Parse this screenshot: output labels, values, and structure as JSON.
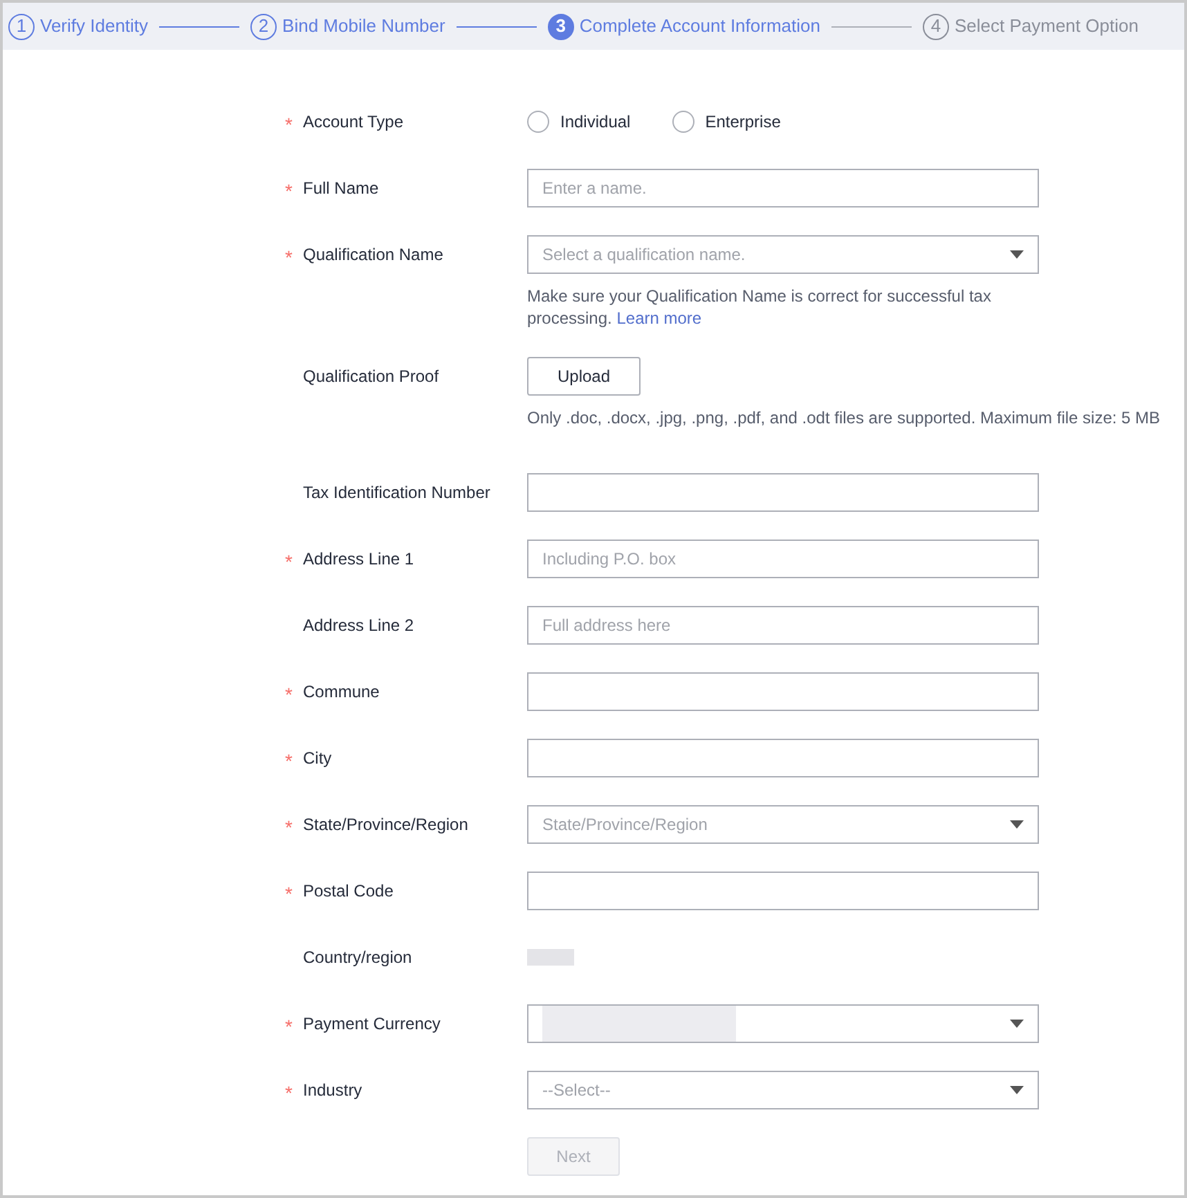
{
  "steps": [
    {
      "number": "1",
      "label": "Verify Identity",
      "completed": true,
      "selected": false
    },
    {
      "number": "2",
      "label": "Bind Mobile Number",
      "completed": true,
      "selected": false
    },
    {
      "number": "3",
      "label": "Complete Account Information",
      "completed": false,
      "selected": true
    },
    {
      "number": "4",
      "label": "Select Payment Option",
      "completed": false,
      "selected": false
    }
  ],
  "form": {
    "required_mark": "*",
    "fields": [
      {
        "kind": "radio",
        "label": "Account Type",
        "required": true,
        "options": [
          {
            "label": "Individual",
            "selected": false
          },
          {
            "label": "Enterprise",
            "selected": false
          }
        ]
      },
      {
        "kind": "input",
        "label": "Full Name",
        "required": true,
        "placeholder": "Enter a name."
      },
      {
        "kind": "select",
        "label": "Qualification Name",
        "required": true,
        "placeholder": "Select a qualification name.",
        "hint": "Make sure your Qualification Name is correct for successful tax processing.",
        "hint_link": "Learn more"
      },
      {
        "kind": "upload",
        "label": "Qualification Proof",
        "required": false,
        "button": "Upload",
        "hint": "Only .doc, .docx, .jpg, .png, .pdf, and .odt files are supported. Maximum file size: 5 MB"
      },
      {
        "kind": "input",
        "label": "Tax Identification Number",
        "required": false
      },
      {
        "kind": "input",
        "label": "Address Line 1",
        "required": true,
        "placeholder": "Including P.O. box"
      },
      {
        "kind": "input",
        "label": "Address Line 2",
        "required": false,
        "placeholder": "Full address here"
      },
      {
        "kind": "input",
        "label": "Commune",
        "required": true
      },
      {
        "kind": "input",
        "label": "City",
        "required": true
      },
      {
        "kind": "select",
        "label": "State/Province/Region",
        "required": true,
        "placeholder": "State/Province/Region"
      },
      {
        "kind": "input",
        "label": "Postal Code",
        "required": true
      },
      {
        "kind": "blurred",
        "label": "Country/region",
        "required": false
      },
      {
        "kind": "blurred-select",
        "label": "Payment Currency",
        "required": true
      },
      {
        "kind": "select",
        "label": "Industry",
        "required": true,
        "placeholder": "--Select--"
      }
    ],
    "next_button": {
      "label": "Next",
      "disabled": true
    }
  }
}
